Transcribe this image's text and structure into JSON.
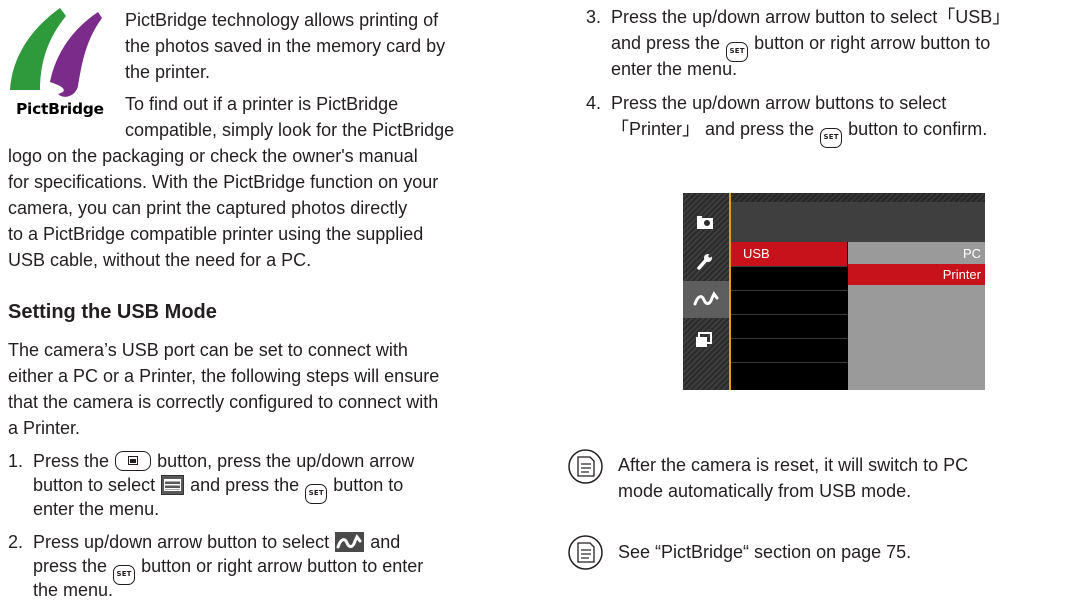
{
  "logo": {
    "text": "PictBridge"
  },
  "intro": {
    "l1": "PictBridge technology allows printing of",
    "l2": "the photos saved in the memory card by",
    "l3": "the printer.",
    "l4": "To find out if a printer is PictBridge",
    "l5": "compatible, simply look for the PictBridge",
    "l6": "logo on the packaging or check the owner's manual",
    "l7": "for specifications. With the PictBridge function on your",
    "l8": "camera, you can print the captured photos directly",
    "l9": "to a PictBridge compatible printer using the supplied",
    "l10": "USB cable, without the need for a PC."
  },
  "section": {
    "heading": "Setting the USB Mode",
    "l1": "The camera’s USB port can be set to connect with",
    "l2": "either a PC or a Printer, the following steps will ensure",
    "l3": "that the camera is correctly configured to connect with",
    "l4": "a Printer."
  },
  "step1": {
    "num": "1.",
    "a": "Press the",
    "b": "button, press the up/down arrow",
    "c": "button to select",
    "d": "and press the",
    "e": "button to",
    "f": "enter the menu."
  },
  "step2": {
    "num": "2.",
    "a": "Press up/down arrow button to select",
    "b": "and",
    "c": "press the",
    "d": "button or right arrow button to enter",
    "e": "the menu."
  },
  "step3": {
    "num": "3.",
    "a": "Press the up/down arrow button to select「USB」",
    "b": "and press the",
    "c": "button or right arrow button to",
    "d": "enter the menu."
  },
  "step4": {
    "num": "4.",
    "a": "Press the up/down arrow buttons to select",
    "b": "「Printer」 and press the",
    "c": "button to confirm."
  },
  "set_label": "SET",
  "camera_screen": {
    "menu_item": "USB",
    "options": [
      "PC",
      "Printer"
    ],
    "selected_option": "Printer",
    "sidebar_icons": [
      "camera-icon",
      "wrench-icon",
      "connection-icon",
      "playback-print-icon"
    ],
    "colors": {
      "highlight": "#c7111b",
      "accent": "#e69b1a"
    }
  },
  "notes": {
    "n1_l1": "After the camera is reset, it will switch to PC",
    "n1_l2": "mode automatically from USB mode.",
    "n2": "See “PictBridge“ section on page 75."
  }
}
